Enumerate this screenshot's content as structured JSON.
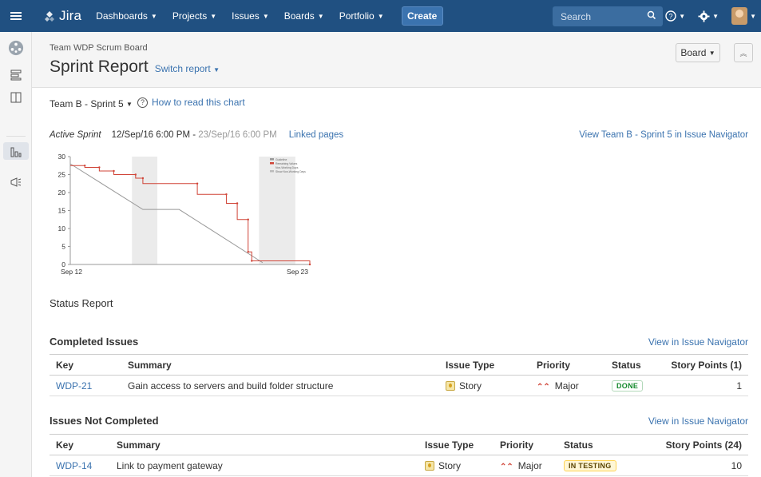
{
  "topnav": {
    "logo": "Jira",
    "items": [
      {
        "label": "Dashboards"
      },
      {
        "label": "Projects"
      },
      {
        "label": "Issues"
      },
      {
        "label": "Boards"
      },
      {
        "label": "Portfolio"
      }
    ],
    "create_label": "Create",
    "search_placeholder": "Search"
  },
  "header": {
    "board_name": "Team WDP Scrum Board",
    "title": "Sprint Report",
    "switch_report": "Switch report",
    "board_button": "Board"
  },
  "sprint": {
    "selector": "Team B - Sprint 5",
    "how_to": "How to read this chart",
    "active_label": "Active Sprint",
    "start": "12/Sep/16 6:00 PM",
    "separator": " - ",
    "end": "23/Sep/16 6:00 PM",
    "linked_pages": "Linked pages",
    "view_navigator": "View Team B - Sprint 5 in Issue Navigator"
  },
  "chart_data": {
    "type": "line",
    "x_labels": [
      "Sep 12",
      "Sep 23"
    ],
    "yticks": [
      0,
      5,
      10,
      15,
      20,
      25,
      30
    ],
    "ylim": [
      0,
      30
    ],
    "legend": [
      "Guideline",
      "Remaining Values",
      "Non-Working Days",
      "Show Non-Working Days"
    ],
    "legend_placement": "top-right",
    "series": [
      {
        "name": "Guideline",
        "color": "#999999",
        "points": [
          [
            0,
            28
          ],
          [
            10,
            15.3
          ],
          [
            15,
            15.3
          ],
          [
            26.5,
            0.5
          ]
        ]
      },
      {
        "name": "Remaining Values",
        "color": "#d04437",
        "points": [
          [
            0,
            27.5
          ],
          [
            2,
            27.5
          ],
          [
            2,
            27
          ],
          [
            4,
            27
          ],
          [
            4,
            26
          ],
          [
            6,
            26
          ],
          [
            6,
            25
          ],
          [
            9,
            25
          ],
          [
            9,
            24
          ],
          [
            10,
            24
          ],
          [
            10,
            22.5
          ],
          [
            17.5,
            22.5
          ],
          [
            17.5,
            19.5
          ],
          [
            21.5,
            19.5
          ],
          [
            21.5,
            17
          ],
          [
            23,
            17
          ],
          [
            23,
            12.5
          ],
          [
            24.5,
            12.5
          ],
          [
            24.5,
            9
          ],
          [
            24.5,
            3.5
          ],
          [
            25,
            3.5
          ],
          [
            25,
            1
          ],
          [
            33,
            1
          ],
          [
            33,
            0
          ]
        ]
      }
    ],
    "non_working_bands": [
      [
        8.5,
        12
      ],
      [
        26,
        31
      ]
    ],
    "x_domain": [
      0,
      33
    ],
    "colors": {
      "guideline": "#999999",
      "remaining": "#d04437",
      "nonworking": "#ebebeb"
    }
  },
  "status_report": "Status Report",
  "completed": {
    "title": "Completed Issues",
    "link": "View in Issue Navigator",
    "columns": [
      "Key",
      "Summary",
      "Issue Type",
      "Priority",
      "Status",
      "Story Points (1)"
    ],
    "rows": [
      {
        "key": "WDP-21",
        "summary": "Gain access to servers and build folder structure",
        "type": "Story",
        "priority": "Major",
        "status": "DONE",
        "points": "1"
      }
    ]
  },
  "not_completed": {
    "title": "Issues Not Completed",
    "link": "View in Issue Navigator",
    "columns": [
      "Key",
      "Summary",
      "Issue Type",
      "Priority",
      "Status",
      "Story Points (24)"
    ],
    "rows": [
      {
        "key": "WDP-14",
        "summary": "Link to payment gateway",
        "type": "Story",
        "priority": "Major",
        "status": "IN TESTING",
        "points": "10"
      }
    ]
  },
  "colors": {
    "brand": "#205081",
    "link": "#3b73af",
    "priority_major": "#d04437"
  }
}
